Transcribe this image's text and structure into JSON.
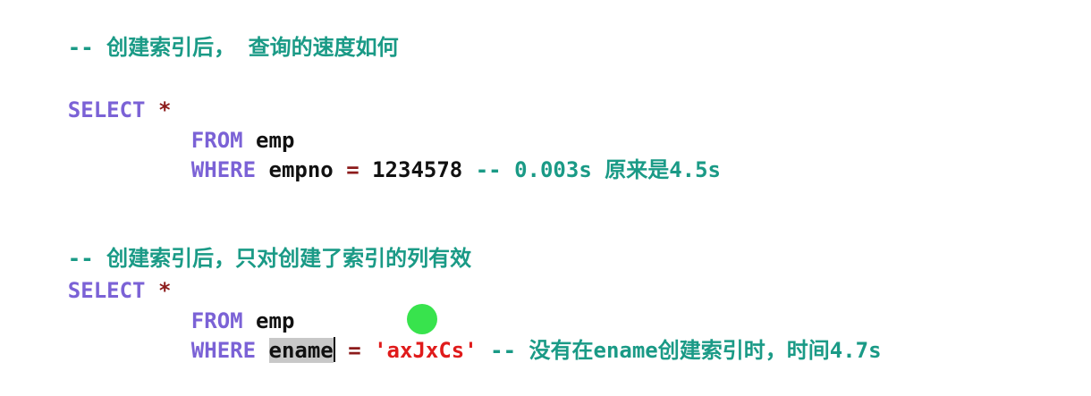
{
  "editor": {
    "lines": {
      "comment1": "-- 创建索引后， 查询的速度如何",
      "select1_keyword": "SELECT",
      "select1_star": "*",
      "from1_keyword": "FROM",
      "from1_table": "emp",
      "where1_keyword": "WHERE",
      "where1_column": "empno",
      "where1_eq": "=",
      "where1_value": "1234578",
      "where1_comment": "-- 0.003s 原来是4.5s",
      "comment2": "-- 创建索引后，只对创建了索引的列有效",
      "select2_keyword": "SELECT",
      "select2_star": "*",
      "from2_keyword": "FROM",
      "from2_table": "emp",
      "where2_keyword": "WHERE",
      "where2_column": "ename",
      "where2_eq": "=",
      "where2_value": "'axJxCs'",
      "where2_comment": "-- 没有在ename创建索引时，时间4.7s"
    }
  },
  "colors": {
    "comment": "#1a9a86",
    "keyword": "#7b62d6",
    "operator": "#8c1b1b",
    "string": "#e01b1b",
    "selection": "#c8c8c8",
    "cursor_highlight": "#22e03a"
  }
}
